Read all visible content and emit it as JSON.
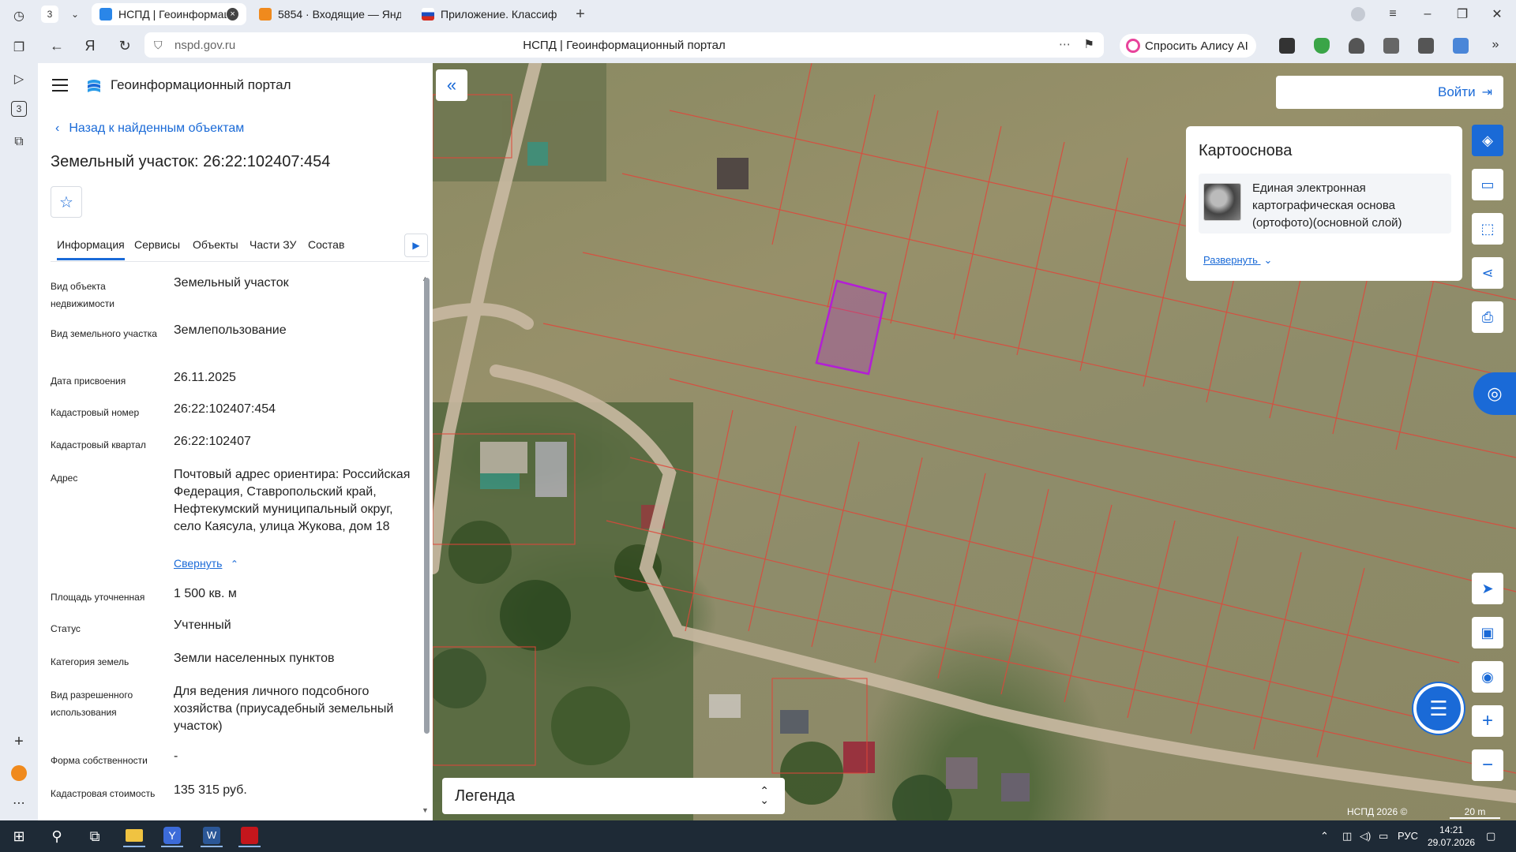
{
  "browser": {
    "tab_counter": "3",
    "tabs": [
      {
        "label": "НСПД | Геоинформаци",
        "active": true
      },
      {
        "label": "5854 · Входящие — Яндек",
        "active": false
      },
      {
        "label": "Приложение. Классифик",
        "active": false
      }
    ],
    "url": "nspd.gov.ru",
    "page_title": "НСПД | Геоинформационный портал",
    "alice_label": "Спросить Алису AI",
    "sidebar_badge": "3"
  },
  "app": {
    "title": "Геоинформационный портал",
    "back_label": "Назад к найденным объектам",
    "parcel_title": "Земельный участок: 26:22:102407:454",
    "tabs": [
      "Информация",
      "Сервисы",
      "Объекты",
      "Части ЗУ",
      "Состав"
    ],
    "attributes": [
      {
        "label": "Вид объекта недвижимости",
        "value": "Земельный участок"
      },
      {
        "label": "Вид земельного участка",
        "value": "Землепользование"
      },
      {
        "label": "Дата присвоения",
        "value": "26.11.2025"
      },
      {
        "label": "Кадастровый номер",
        "value": "26:22:102407:454"
      },
      {
        "label": "Кадастровый квартал",
        "value": "26:22:102407"
      },
      {
        "label": "Адрес",
        "value": "Почтовый адрес ориентира: Российская Федерация, Ставропольский край, Нефтекумский муниципальный округ, село Каясула, улица Жукова, дом 18"
      },
      {
        "label": "Площадь уточненная",
        "value": "1 500 кв. м"
      },
      {
        "label": "Статус",
        "value": "Учтенный"
      },
      {
        "label": "Категория земель",
        "value": "Земли населенных пунктов"
      },
      {
        "label": "Вид разрешенного использования",
        "value": "Для ведения личного подсобного хозяйства (приусадебный земельный участок)"
      },
      {
        "label": "Форма собственности",
        "value": "-"
      },
      {
        "label": "Кадастровая стоимость",
        "value": "135 315 руб."
      }
    ],
    "collapse_label": "Свернуть"
  },
  "map": {
    "login_label": "Войти",
    "basemap_title": "Картооснова",
    "basemap_item": "Единая электронная картографическая основа (ортофото)(основной слой)",
    "basemap_expand": "Развернуть",
    "legend_label": "Легенда",
    "copyright": "НСПД 2026 ©",
    "scale": "20 m"
  },
  "taskbar": {
    "lang": "РУС",
    "time": "14:21",
    "date": "29.07.2026"
  },
  "colors": {
    "accent": "#1a6ad7",
    "parcel_lines": "#e0463a",
    "selected_parcel": "#b31ed6"
  }
}
